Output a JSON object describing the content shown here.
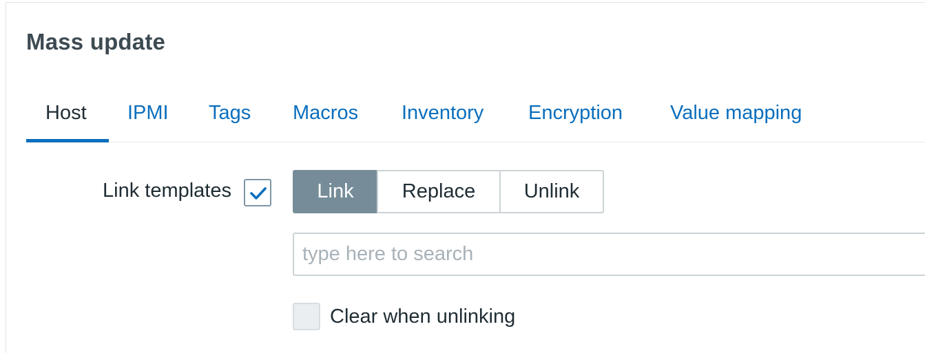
{
  "dialog": {
    "title": "Mass update"
  },
  "tabs": [
    {
      "label": "Host",
      "active": true
    },
    {
      "label": "IPMI",
      "active": false
    },
    {
      "label": "Tags",
      "active": false
    },
    {
      "label": "Macros",
      "active": false
    },
    {
      "label": "Inventory",
      "active": false
    },
    {
      "label": "Encryption",
      "active": false
    },
    {
      "label": "Value mapping",
      "active": false
    }
  ],
  "link_templates": {
    "label": "Link templates",
    "checked": true,
    "modes": [
      {
        "label": "Link",
        "selected": true
      },
      {
        "label": "Replace",
        "selected": false
      },
      {
        "label": "Unlink",
        "selected": false
      }
    ],
    "search": {
      "value": "",
      "placeholder": "type here to search"
    },
    "clear_when_unlinking": {
      "label": "Clear when unlinking",
      "checked": false,
      "disabled": true
    }
  },
  "colors": {
    "accent": "#0a6ebd",
    "segment_active": "#768d99",
    "text": "#1f2c33",
    "title": "#3d4a52"
  }
}
